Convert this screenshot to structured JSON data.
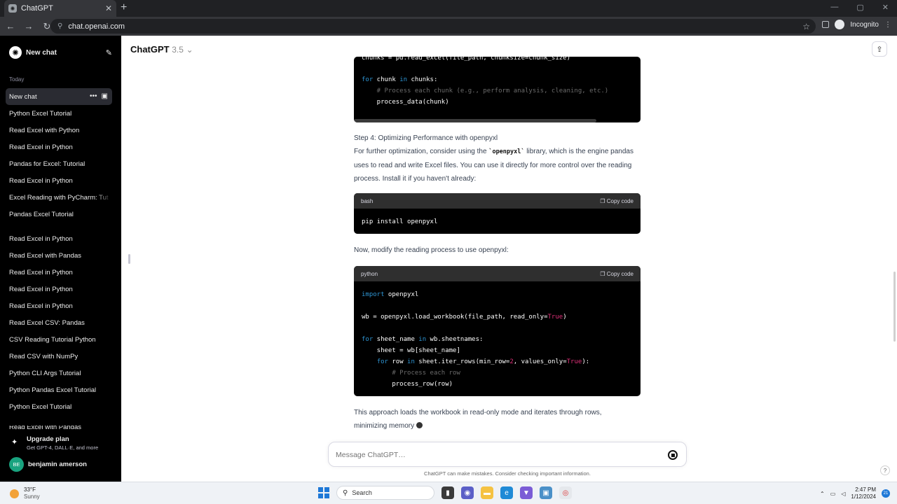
{
  "browser": {
    "tab_title": "ChatGPT",
    "url": "chat.openai.com",
    "profile_label": "Incognito"
  },
  "sidebar": {
    "new_chat_label": "New chat",
    "section_label": "Today",
    "active_item": "New chat",
    "items": [
      "Python Excel Tutorial",
      "Read Excel with Python",
      "Read Excel in Python",
      "Pandas for Excel: Tutorial",
      "Read Excel in Python",
      "Excel Reading with PyCharm: Tut",
      "Pandas Excel Tutorial"
    ],
    "items2": [
      "Read Excel in Python",
      "Read Excel with Pandas",
      "Read Excel in Python",
      "Read Excel in Python",
      "Read Excel in Python",
      "Read Excel CSV: Pandas",
      "CSV Reading Tutorial Python",
      "Read CSV with NumPy",
      "Python CLI Args Tutorial",
      "Python Pandas Excel Tutorial",
      "Python Excel Tutorial"
    ],
    "cutoff_item": "Read Excel with Pandas",
    "upgrade_title": "Upgrade plan",
    "upgrade_sub": "Get GPT-4, DALL·E, and more",
    "user_initials": "BE",
    "user_name": "benjamin amerson"
  },
  "header": {
    "model_name": "ChatGPT",
    "model_version": "3.5"
  },
  "content": {
    "code1_line0": "chunks = pd.read_excel(file_path, chunksize=chunk_size)",
    "code1_for_kw": "for",
    "code1_for_mid": " chunk ",
    "code1_in_kw": "in",
    "code1_for_end": " chunks:",
    "code1_comment": "    # Process each chunk (e.g., perform analysis, cleaning, etc.)",
    "code1_call": "    process_data(chunk)",
    "step4_title": "Step 4: Optimizing Performance with openpyxl",
    "step4_para_a": "For further optimization, consider using the ",
    "step4_para_code": "`openpyxl`",
    "step4_para_b": " library, which is the engine pandas uses to read and write Excel files. You can use it directly for more control over the reading process. Install it if you haven't already:",
    "bash_lang": "bash",
    "copy_label": "Copy code",
    "bash_cmd": "pip install openpyxl",
    "now_text": "Now, modify the reading process to use openpyxl:",
    "python_lang": "python",
    "py_import_kw": "import",
    "py_import_mod": " openpyxl",
    "py_wb_a": "wb = openpyxl.load_workbook(file_path, read_only=",
    "py_true": "True",
    "py_close": ")",
    "py_for1_kw": "for",
    "py_for1_mid": " sheet_name ",
    "py_in_kw": "in",
    "py_for1_end": " wb.sheetnames:",
    "py_sheet": "    sheet = wb[sheet_name]",
    "py_for2_indent": "    ",
    "py_for2_mid": " row ",
    "py_for2_iter": " sheet.iter_rows(min_row=",
    "py_two": "2",
    "py_for2_vals": ", values_only=",
    "py_for2_end": "):",
    "py_comment": "        # Process each row",
    "py_call": "        process_row(row)",
    "final_text": "This approach loads the workbook in read-only mode and iterates through rows, minimizing memory"
  },
  "composer": {
    "placeholder": "Message ChatGPT…",
    "disclaimer": "ChatGPT can make mistakes. Consider checking important information.",
    "help": "?"
  },
  "taskbar": {
    "temp": "33°F",
    "condition": "Sunny",
    "search_label": "Search",
    "time": "2:47 PM",
    "date": "1/12/2024",
    "notif_count": "21"
  }
}
